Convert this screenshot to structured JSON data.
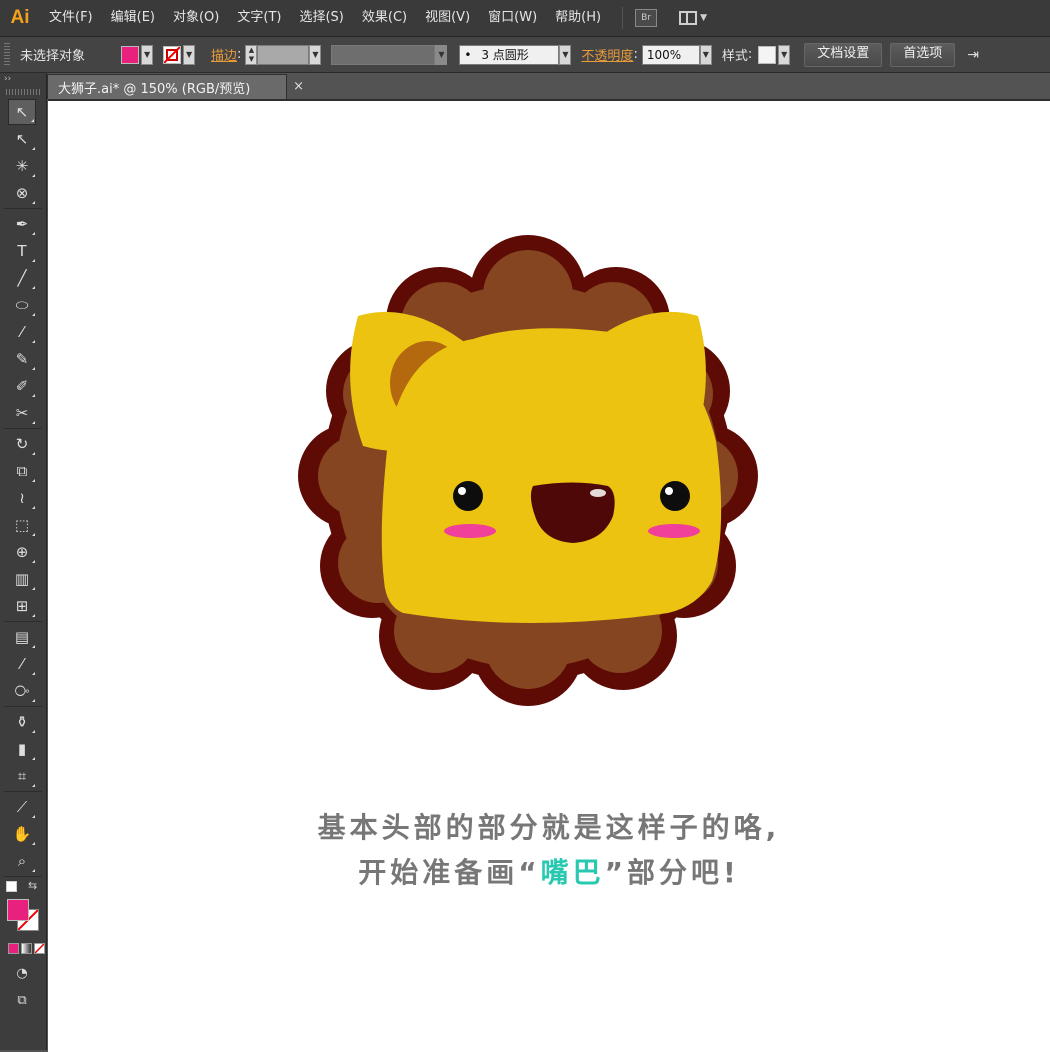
{
  "menubar": {
    "logo": "Ai",
    "items": [
      "文件(F)",
      "编辑(E)",
      "对象(O)",
      "文字(T)",
      "选择(S)",
      "效果(C)",
      "视图(V)",
      "窗口(W)",
      "帮助(H)"
    ],
    "bridge_label": "Br"
  },
  "controlbar": {
    "selection_label": "未选择对象",
    "fill_color": "#e8207e",
    "stroke_label": "描边",
    "brush_value": "3 点圆形",
    "opacity_label": "不透明度",
    "opacity_value": "100%",
    "style_label": "样式",
    "doc_setup_button": "文档设置",
    "preferences_button": "首选项"
  },
  "document": {
    "tab_title": "大狮子.ai* @ 150% (RGB/预览)",
    "close_glyph": "×"
  },
  "tools": [
    {
      "name": "selection-tool-icon",
      "glyph": "↖"
    },
    {
      "name": "direct-selection-tool-icon",
      "glyph": "↖"
    },
    {
      "name": "magic-wand-tool-icon",
      "glyph": "✳"
    },
    {
      "name": "lasso-tool-icon",
      "glyph": "⊗"
    },
    {
      "name": "pen-tool-icon",
      "glyph": "✒"
    },
    {
      "name": "type-tool-icon",
      "glyph": "T"
    },
    {
      "name": "line-tool-icon",
      "glyph": "╱"
    },
    {
      "name": "ellipse-tool-icon",
      "glyph": "⬭"
    },
    {
      "name": "paintbrush-tool-icon",
      "glyph": "⁄"
    },
    {
      "name": "pencil-tool-icon",
      "glyph": "✎"
    },
    {
      "name": "blob-brush-tool-icon",
      "glyph": "✐"
    },
    {
      "name": "scissors-tool-icon",
      "glyph": "✂"
    },
    {
      "name": "rotate-tool-icon",
      "glyph": "↻"
    },
    {
      "name": "scale-tool-icon",
      "glyph": "⧉"
    },
    {
      "name": "width-tool-icon",
      "glyph": "≀"
    },
    {
      "name": "free-transform-tool-icon",
      "glyph": "⬚"
    },
    {
      "name": "shape-builder-tool-icon",
      "glyph": "⊕"
    },
    {
      "name": "perspective-grid-tool-icon",
      "glyph": "▥"
    },
    {
      "name": "mesh-tool-icon",
      "glyph": "⊞"
    },
    {
      "name": "gradient-tool-icon",
      "glyph": "▤"
    },
    {
      "name": "eyedropper-tool-icon",
      "glyph": "⁄"
    },
    {
      "name": "blend-tool-icon",
      "glyph": "⧂"
    },
    {
      "name": "symbol-sprayer-tool-icon",
      "glyph": "⚱"
    },
    {
      "name": "column-graph-tool-icon",
      "glyph": "▮"
    },
    {
      "name": "artboard-tool-icon",
      "glyph": "⌗"
    },
    {
      "name": "slice-tool-icon",
      "glyph": "⟋"
    },
    {
      "name": "hand-tool-icon",
      "glyph": "✋"
    },
    {
      "name": "zoom-tool-icon",
      "glyph": "⌕"
    }
  ],
  "toolbar_colors": {
    "fill": "#e8207e",
    "stroke": "none"
  },
  "artwork": {
    "mane_outline": "#5e0a05",
    "mane": "#844520",
    "face": "#ecc310",
    "inner_ear": "#b4690f",
    "eyes": "#0d0d0d",
    "mouth": "#4e0808",
    "cheeks": "#f0409a"
  },
  "caption": {
    "line1": "基本头部的部分就是这样子的咯,",
    "line2_before": "开始准备画“",
    "line2_accent": "嘴巴",
    "line2_after": "”部分吧!",
    "accent_color": "#28c9b0"
  }
}
